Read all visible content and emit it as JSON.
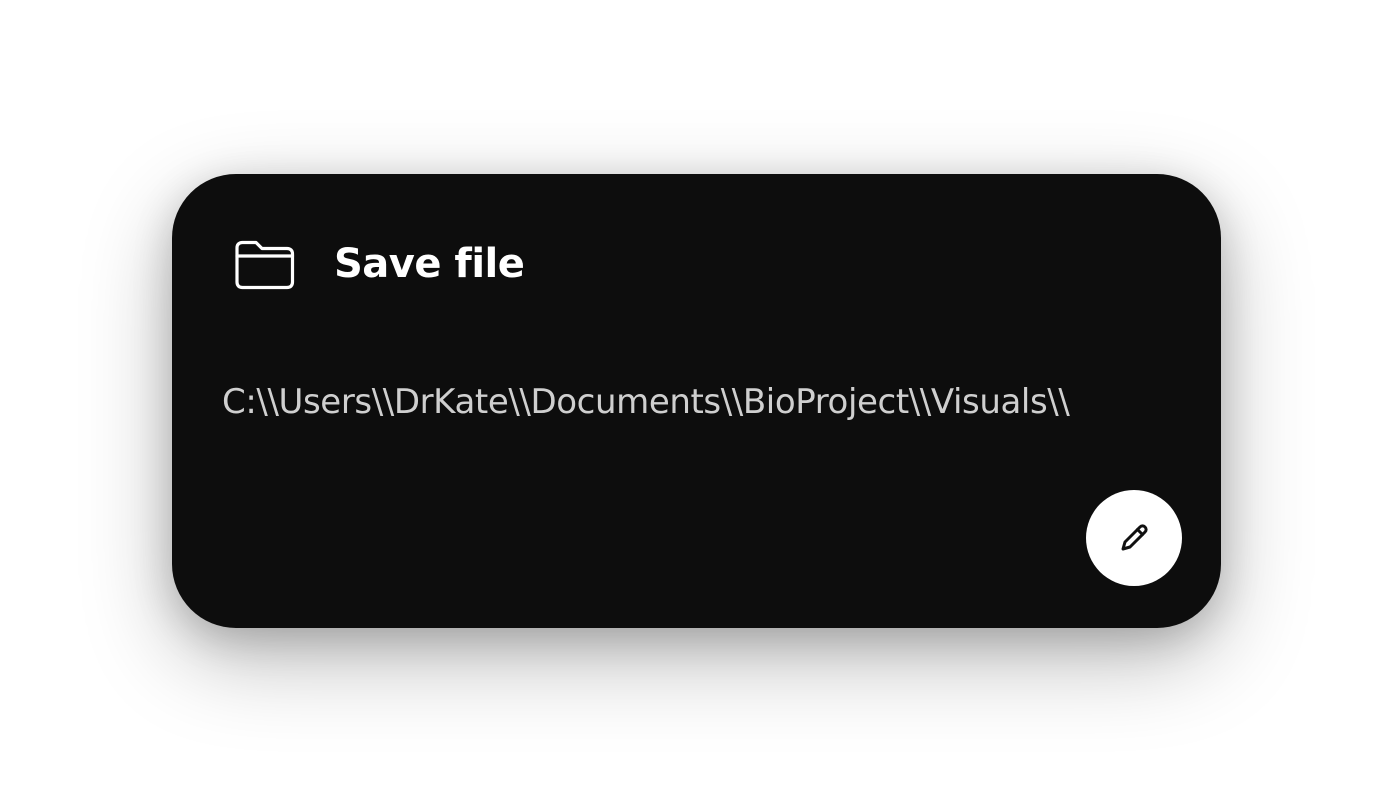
{
  "dialog": {
    "title": "Save file",
    "path": "C:\\\\Users\\\\DrKate\\\\Documents\\\\BioProject\\\\Visuals\\\\",
    "icons": {
      "header": "folder-icon",
      "edit": "pencil-icon"
    }
  },
  "colors": {
    "card_background": "#0d0d0d",
    "title_text": "#ffffff",
    "path_text": "#cfcfcf",
    "edit_button": "#ffffff"
  }
}
